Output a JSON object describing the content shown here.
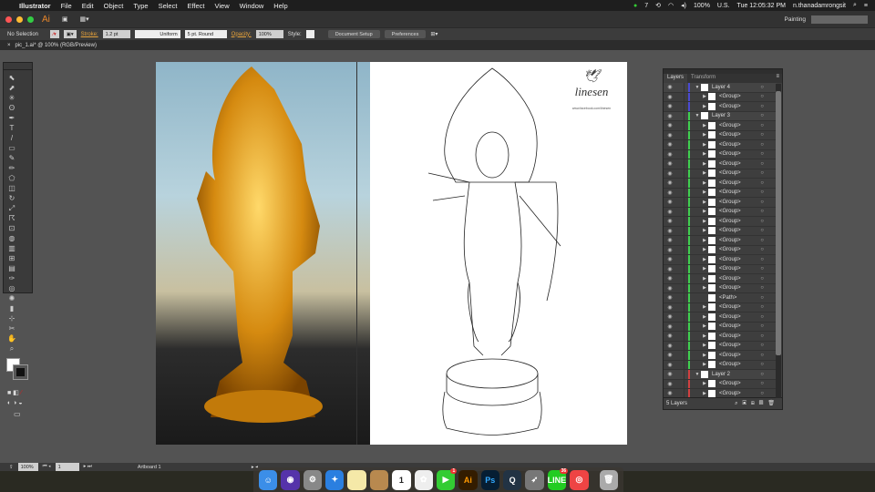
{
  "menubar": {
    "app": "Illustrator",
    "items": [
      "File",
      "Edit",
      "Object",
      "Type",
      "Select",
      "Effect",
      "View",
      "Window",
      "Help"
    ],
    "status": {
      "notif": "7",
      "battery": "100%",
      "input": "U.S.",
      "clock": "Tue 12:05:32 PM",
      "user": "n.thanadamrongsit"
    }
  },
  "titlebar": {
    "app_logo": "Ai",
    "workspace": "Painting",
    "search_placeholder": ""
  },
  "control": {
    "selection": "No Selection",
    "stroke_label": "Stroke:",
    "stroke_value": "1.2 pt",
    "profile": "Uniform",
    "brush": "5 pt. Round",
    "opacity_label": "Opacity:",
    "opacity_value": "100%",
    "style_label": "Style:",
    "document_setup": "Document Setup",
    "preferences": "Preferences"
  },
  "document": {
    "tab": "pic_1.ai* @ 100% (RGB/Preview)"
  },
  "artwork": {
    "logo_text": "linesen",
    "logo_sub": "www.facebook.com/linesen"
  },
  "layers": {
    "tabs": [
      "Layers",
      "Transform"
    ],
    "footer": "5 Layers",
    "colors": {
      "layer4": "#4a4ad0",
      "layer3": "#3fcf4f",
      "layer2": "#d04040"
    },
    "rows": [
      {
        "name": "Layer 4",
        "top": true,
        "color": "layer4"
      },
      {
        "name": "<Group>",
        "color": "layer4"
      },
      {
        "name": "<Group>",
        "color": "layer4"
      },
      {
        "name": "Layer 3",
        "top": true,
        "color": "layer3"
      },
      {
        "name": "<Group>",
        "color": "layer3"
      },
      {
        "name": "<Group>",
        "color": "layer3"
      },
      {
        "name": "<Group>",
        "color": "layer3"
      },
      {
        "name": "<Group>",
        "color": "layer3"
      },
      {
        "name": "<Group>",
        "color": "layer3"
      },
      {
        "name": "<Group>",
        "color": "layer3"
      },
      {
        "name": "<Group>",
        "color": "layer3"
      },
      {
        "name": "<Group>",
        "color": "layer3"
      },
      {
        "name": "<Group>",
        "color": "layer3"
      },
      {
        "name": "<Group>",
        "color": "layer3"
      },
      {
        "name": "<Group>",
        "color": "layer3"
      },
      {
        "name": "<Group>",
        "color": "layer3"
      },
      {
        "name": "<Group>",
        "color": "layer3"
      },
      {
        "name": "<Group>",
        "color": "layer3"
      },
      {
        "name": "<Group>",
        "color": "layer3"
      },
      {
        "name": "<Group>",
        "color": "layer3"
      },
      {
        "name": "<Group>",
        "color": "layer3"
      },
      {
        "name": "<Group>",
        "color": "layer3"
      },
      {
        "name": "<Path>",
        "color": "layer3",
        "leaf": true
      },
      {
        "name": "<Group>",
        "color": "layer3"
      },
      {
        "name": "<Group>",
        "color": "layer3"
      },
      {
        "name": "<Group>",
        "color": "layer3"
      },
      {
        "name": "<Group>",
        "color": "layer3"
      },
      {
        "name": "<Group>",
        "color": "layer3"
      },
      {
        "name": "<Group>",
        "color": "layer3"
      },
      {
        "name": "<Group>",
        "color": "layer3"
      },
      {
        "name": "Layer 2",
        "top": true,
        "color": "layer2"
      },
      {
        "name": "<Group>",
        "color": "layer2"
      },
      {
        "name": "<Group>",
        "color": "layer2"
      }
    ]
  },
  "statusbar": {
    "zoom": "100%",
    "artboard_num": "1",
    "artboard_name": "Artboard 1"
  },
  "dock": [
    {
      "name": "finder",
      "label": "☺",
      "bg": "#3b8ee8"
    },
    {
      "name": "siri",
      "label": "◉",
      "bg": "#5533aa"
    },
    {
      "name": "system-preferences",
      "label": "⚙",
      "bg": "#888"
    },
    {
      "name": "safari",
      "label": "✦",
      "bg": "#2a7fe0"
    },
    {
      "name": "notes",
      "label": "",
      "bg": "#f5e9a8"
    },
    {
      "name": "contacts",
      "label": "",
      "bg": "#b8894f"
    },
    {
      "name": "calendar",
      "label": "1",
      "bg": "#fff"
    },
    {
      "name": "photos",
      "label": "✿",
      "bg": "#eee"
    },
    {
      "name": "facetime",
      "label": "▶",
      "bg": "#3c3",
      "badge": "1"
    },
    {
      "name": "illustrator",
      "label": "Ai",
      "bg": "#331c00"
    },
    {
      "name": "photoshop",
      "label": "Ps",
      "bg": "#061e33"
    },
    {
      "name": "quicktime",
      "label": "Q",
      "bg": "#234"
    },
    {
      "name": "launchpad",
      "label": "➶",
      "bg": "#777"
    },
    {
      "name": "line",
      "label": "LINE",
      "bg": "#2c2",
      "badge": "36"
    },
    {
      "name": "chrome",
      "label": "◎",
      "bg": "#e44"
    },
    {
      "name": "trash",
      "label": "🗑",
      "bg": "#aaa"
    }
  ]
}
